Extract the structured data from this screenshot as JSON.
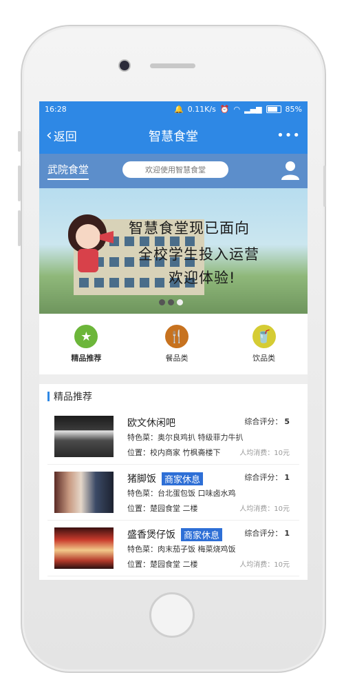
{
  "status": {
    "time": "16:28",
    "speed": "0.11K/s",
    "battery": "85%"
  },
  "nav": {
    "back_label": "返回",
    "title": "智慧食堂",
    "more": "•••"
  },
  "subbar": {
    "cafeteria": "武院食堂",
    "search_placeholder": "欢迎使用智慧食堂"
  },
  "banner": {
    "line1": "智慧食堂现已面向",
    "line2": "全校学生投入运营",
    "line3": "欢迎体验!"
  },
  "categories": [
    {
      "label": "精品推荐",
      "icon": "star-icon",
      "color": "#6cb63a"
    },
    {
      "label": "餐品类",
      "icon": "fork-knife-icon",
      "color": "#c7721f"
    },
    {
      "label": "饮品类",
      "icon": "drink-icon",
      "color": "#d5cc34"
    }
  ],
  "section": {
    "title": "精品推荐"
  },
  "restaurants": [
    {
      "name": "欧文休闲吧",
      "tag": "",
      "score_label": "综合评分：",
      "score": "5",
      "dish": "特色菜：奥尔良鸡扒 特级菲力牛扒",
      "location": "位置：校内商家 竹枫斋楼下",
      "price": "人均消费：10元"
    },
    {
      "name": "猪脚饭",
      "tag": "商家休息",
      "score_label": "综合评分：",
      "score": "1",
      "dish": "特色菜：台北蛋包饭 口味卤水鸡",
      "location": "位置：楚园食堂 二楼",
      "price": "人均消费：10元"
    },
    {
      "name": "盛香煲仔饭",
      "tag": "商家休息",
      "score_label": "综合评分：",
      "score": "1",
      "dish": "特色菜：肉末茄子饭 梅菜烧鸡饭",
      "location": "位置：楚园食堂 二楼",
      "price": "人均消费：10元"
    }
  ],
  "colors": {
    "primary": "#2e88e5",
    "subbar": "#5c8ecb",
    "tag": "#2e6fd6"
  }
}
